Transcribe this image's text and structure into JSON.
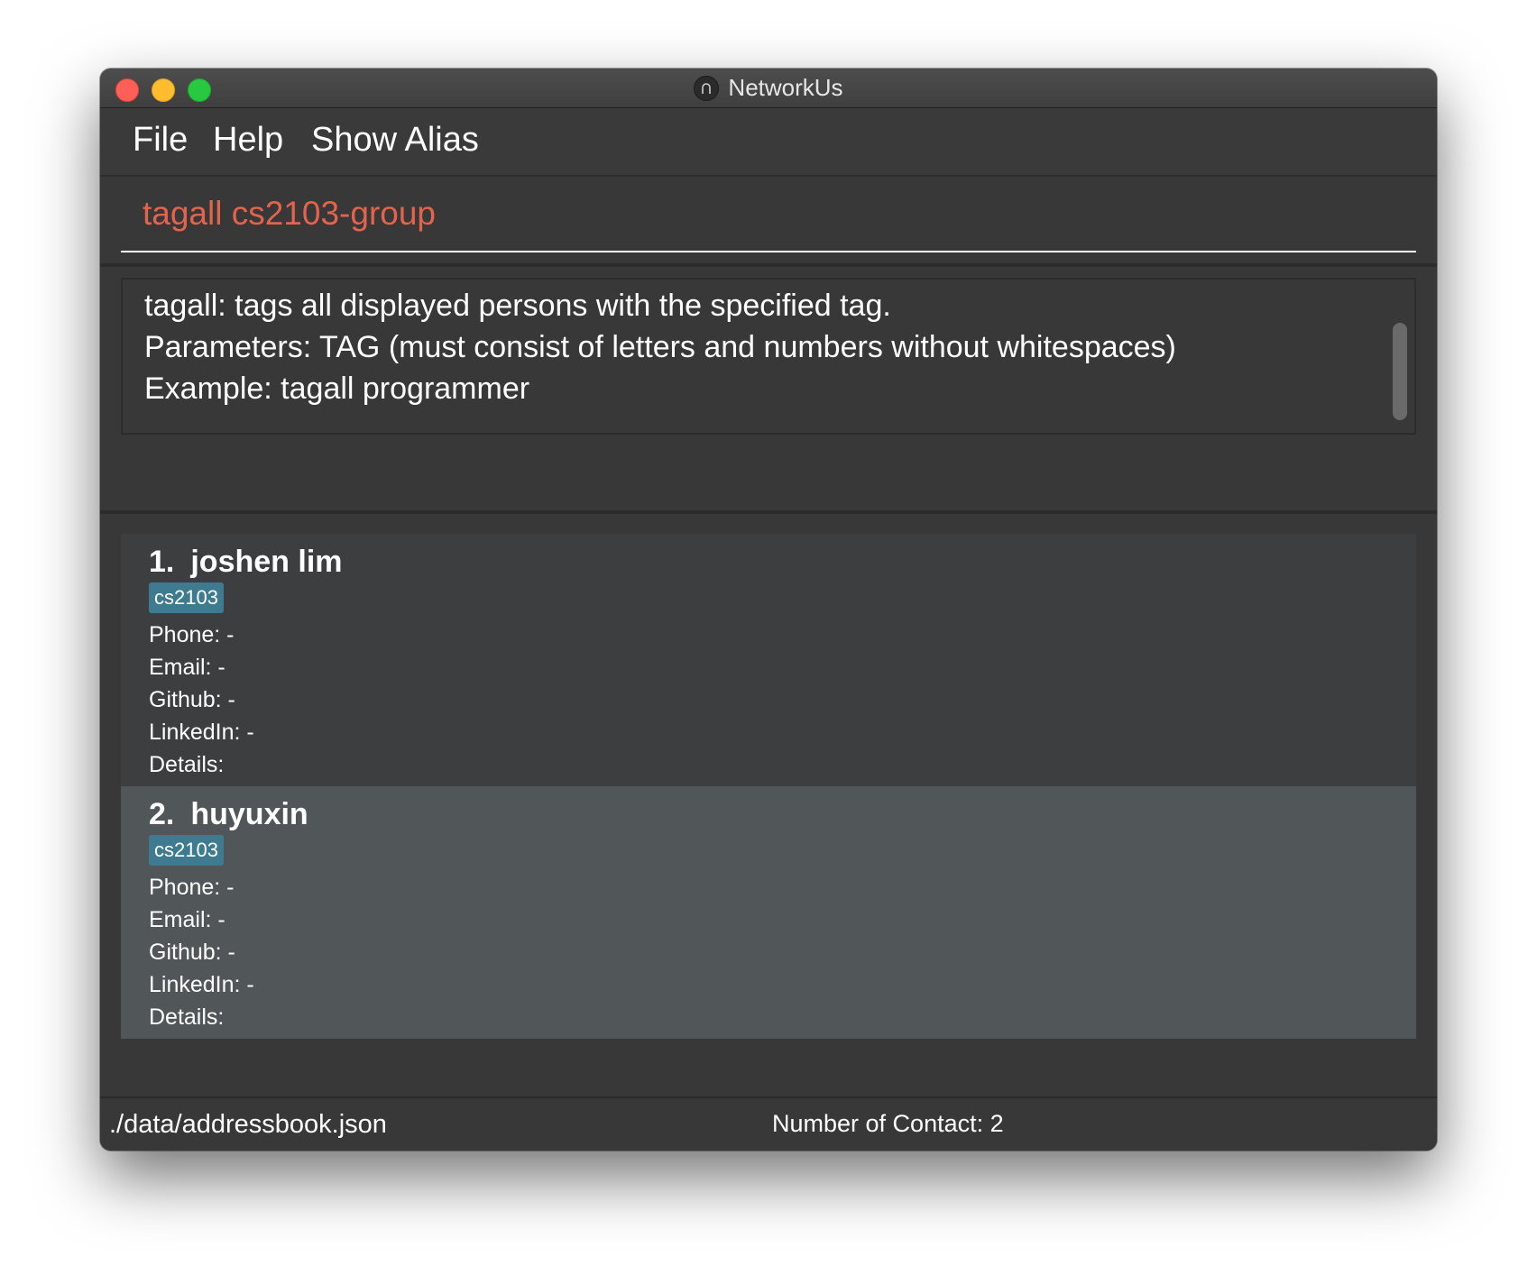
{
  "window": {
    "title": "NetworkUs",
    "app_icon": "app-icon"
  },
  "menu": {
    "items": [
      {
        "label": "File"
      },
      {
        "label": "Help"
      },
      {
        "label": "Show Alias"
      }
    ]
  },
  "command": {
    "value": "tagall cs2103-group"
  },
  "result": {
    "lines": [
      "tagall: tags all displayed persons with the specified tag.",
      "Parameters: TAG (must consist of letters and numbers without whitespaces)",
      "Example: tagall programmer"
    ]
  },
  "persons": [
    {
      "index": "1.",
      "name": "joshen lim",
      "tag": "cs2103",
      "phone": "Phone: -",
      "email": "Email: -",
      "github": "Github: -",
      "linkedin": "LinkedIn: -",
      "details": "Details:"
    },
    {
      "index": "2.",
      "name": "huyuxin",
      "tag": "cs2103",
      "phone": "Phone: -",
      "email": "Email: -",
      "github": "Github: -",
      "linkedin": "LinkedIn: -",
      "details": "Details:"
    }
  ],
  "status": {
    "file_path": "./data/addressbook.json",
    "contact_count": "Number of Contact: 2"
  },
  "colors": {
    "window_bg": "#383838",
    "command_text": "#e2634e",
    "tag_bg": "#3e7b91",
    "selected_card_bg": "#515659"
  }
}
